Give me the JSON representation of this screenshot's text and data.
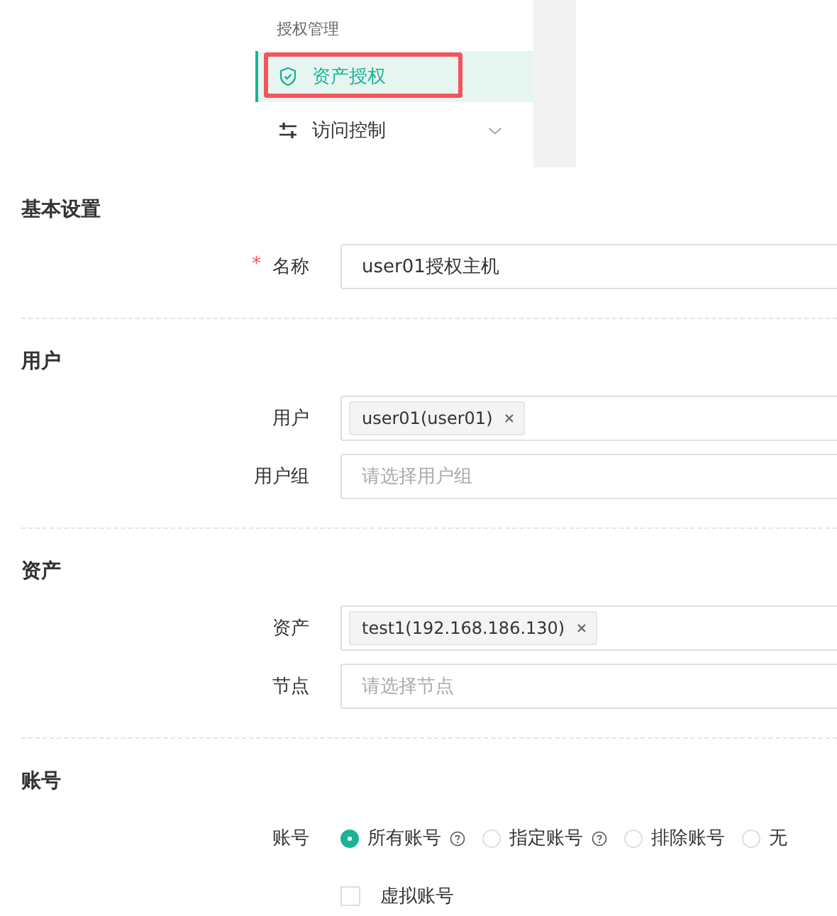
{
  "menu": {
    "group_title": "授权管理",
    "items": [
      {
        "label": "资产授权",
        "selected": true,
        "highlighted": true
      },
      {
        "label": "访问控制",
        "selected": false,
        "highlighted": false,
        "expanded": false
      }
    ]
  },
  "sections": [
    {
      "title": "基本设置",
      "fields": [
        {
          "kind": "text",
          "label": "名称",
          "required_mark": "*",
          "value": "user01授权主机"
        }
      ]
    },
    {
      "title": "用户",
      "fields": [
        {
          "kind": "tags",
          "label": "用户",
          "tags": [
            "user01(user01)"
          ]
        },
        {
          "kind": "select",
          "label": "用户组",
          "placeholder": "请选择用户组"
        }
      ]
    },
    {
      "title": "资产",
      "fields": [
        {
          "kind": "tags",
          "label": "资产",
          "tags": [
            "test1(192.168.186.130)"
          ]
        },
        {
          "kind": "select",
          "label": "节点",
          "placeholder": "请选择节点"
        }
      ]
    },
    {
      "title": "账号",
      "fields": [
        {
          "kind": "radio",
          "label": "账号",
          "options": [
            {
              "label": "所有账号",
              "help": true,
              "selected": true
            },
            {
              "label": "指定账号",
              "help": true,
              "selected": false
            },
            {
              "label": "排除账号",
              "help": false,
              "selected": false
            },
            {
              "label": "无",
              "help": false,
              "selected": false
            }
          ]
        },
        {
          "kind": "checkbox",
          "label": "虚拟账号",
          "checked": false
        }
      ]
    }
  ]
}
